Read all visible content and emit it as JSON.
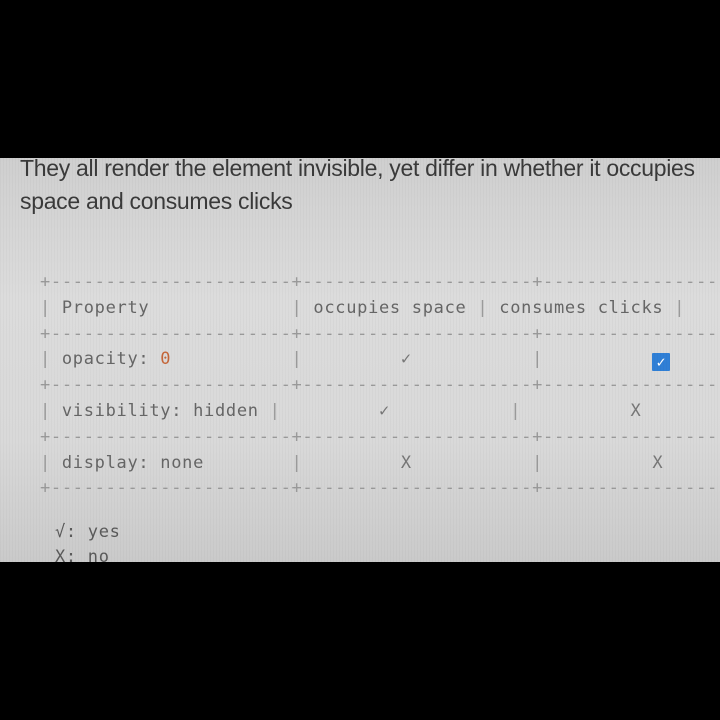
{
  "intro_text": "They all render the element invisible, yet differ in whether it occupies space and consumes clicks",
  "table": {
    "headers": [
      "Property",
      "occupies space",
      "consumes clicks"
    ],
    "rows": [
      {
        "property_prefix": "opacity: ",
        "property_value": "0",
        "occupies_space": "✓",
        "consumes_clicks": "✓"
      },
      {
        "property": "visibility: hidden",
        "occupies_space": "✓",
        "consumes_clicks": "X"
      },
      {
        "property": "display: none",
        "occupies_space": "X",
        "consumes_clicks": "X"
      }
    ]
  },
  "legend": {
    "yes": "√: yes",
    "no": "X: no"
  },
  "colors": {
    "code_value": "#c6673a",
    "checkbox": "#2f7fd6"
  }
}
